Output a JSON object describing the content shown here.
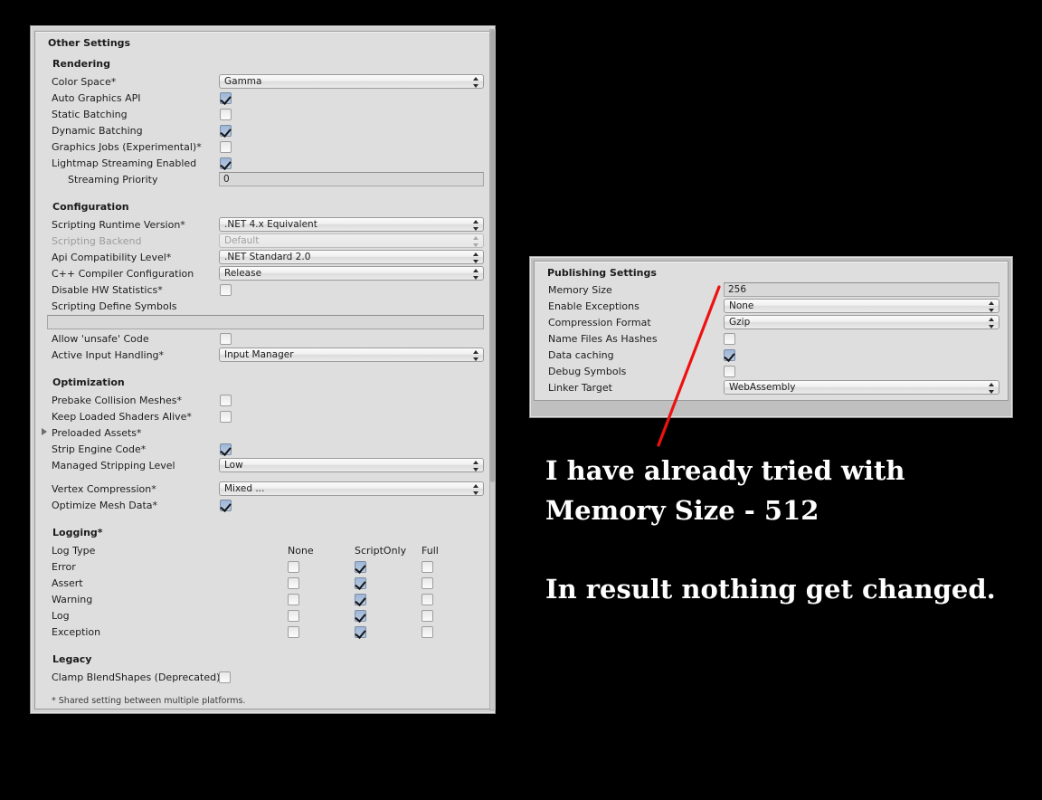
{
  "other_settings": {
    "title": "Other Settings",
    "groups": [
      {
        "name": "Rendering",
        "rows": [
          {
            "label": "Color Space*",
            "type": "dropdown",
            "value": "Gamma"
          },
          {
            "label": "Auto Graphics API",
            "type": "checkbox",
            "checked": true
          },
          {
            "label": "Static Batching",
            "type": "checkbox",
            "checked": false
          },
          {
            "label": "Dynamic Batching",
            "type": "checkbox",
            "checked": true
          },
          {
            "label": "Graphics Jobs (Experimental)*",
            "type": "checkbox",
            "checked": false
          },
          {
            "label": "Lightmap Streaming Enabled",
            "type": "checkbox",
            "checked": true
          },
          {
            "label": "Streaming Priority",
            "type": "textfield",
            "value": "0",
            "indent": true
          }
        ]
      },
      {
        "name": "Configuration",
        "rows": [
          {
            "label": "Scripting Runtime Version*",
            "type": "dropdown",
            "value": ".NET 4.x Equivalent"
          },
          {
            "label": "Scripting Backend",
            "type": "dropdown",
            "value": "Default",
            "disabled": true
          },
          {
            "label": "Api Compatibility Level*",
            "type": "dropdown",
            "value": ".NET Standard 2.0"
          },
          {
            "label": "C++ Compiler Configuration",
            "type": "dropdown",
            "value": "Release"
          },
          {
            "label": "Disable HW Statistics*",
            "type": "checkbox",
            "checked": false
          },
          {
            "label": "Scripting Define Symbols",
            "type": "label-only"
          },
          {
            "label": "",
            "type": "wide-textfield",
            "value": ""
          },
          {
            "label": "Allow 'unsafe' Code",
            "type": "checkbox",
            "checked": false
          },
          {
            "label": "Active Input Handling*",
            "type": "dropdown",
            "value": "Input Manager"
          }
        ]
      },
      {
        "name": "Optimization",
        "rows": [
          {
            "label": "Prebake Collision Meshes*",
            "type": "checkbox",
            "checked": false
          },
          {
            "label": "Keep Loaded Shaders Alive*",
            "type": "checkbox",
            "checked": false
          },
          {
            "label": "Preloaded Assets*",
            "type": "foldout",
            "expanded": false
          },
          {
            "label": "Strip Engine Code*",
            "type": "checkbox",
            "checked": true
          },
          {
            "label": "Managed Stripping Level",
            "type": "dropdown",
            "value": "Low"
          },
          {
            "label": "Vertex Compression*",
            "type": "dropdown",
            "value": "Mixed ..."
          },
          {
            "label": "Optimize Mesh Data*",
            "type": "checkbox",
            "checked": true
          }
        ]
      }
    ],
    "logging": {
      "name": "Logging*",
      "row_header": "Log Type",
      "columns": [
        "None",
        "ScriptOnly",
        "Full"
      ],
      "rows": [
        {
          "label": "Error",
          "selected": "ScriptOnly"
        },
        {
          "label": "Assert",
          "selected": "ScriptOnly"
        },
        {
          "label": "Warning",
          "selected": "ScriptOnly"
        },
        {
          "label": "Log",
          "selected": "ScriptOnly"
        },
        {
          "label": "Exception",
          "selected": "ScriptOnly"
        }
      ]
    },
    "legacy": {
      "name": "Legacy",
      "rows": [
        {
          "label": "Clamp BlendShapes (Deprecated)*",
          "type": "checkbox",
          "checked": false
        }
      ]
    },
    "footnote": "* Shared setting between multiple platforms."
  },
  "publishing_settings": {
    "title": "Publishing Settings",
    "rows": [
      {
        "label": "Memory Size",
        "type": "textfield",
        "value": "256"
      },
      {
        "label": "Enable Exceptions",
        "type": "dropdown",
        "value": "None"
      },
      {
        "label": "Compression Format",
        "type": "dropdown",
        "value": "Gzip"
      },
      {
        "label": "Name Files As Hashes",
        "type": "checkbox",
        "checked": false
      },
      {
        "label": "Data caching",
        "type": "checkbox",
        "checked": true
      },
      {
        "label": "Debug Symbols",
        "type": "checkbox",
        "checked": false
      },
      {
        "label": "Linker Target",
        "type": "dropdown",
        "value": "WebAssembly"
      }
    ]
  },
  "annotation": {
    "line1": "I have already  tried with",
    "line2": " Memory Size - 512",
    "line3": "In result nothing get changed.",
    "arrow_color": "#ee1111"
  },
  "colors": {
    "background": "#000000",
    "panel": "#dedede",
    "frame": "#d2d2d2",
    "checkbox_on": "#9eb6d6",
    "arrow": "#ee1111",
    "text": "#1d1d1d"
  }
}
